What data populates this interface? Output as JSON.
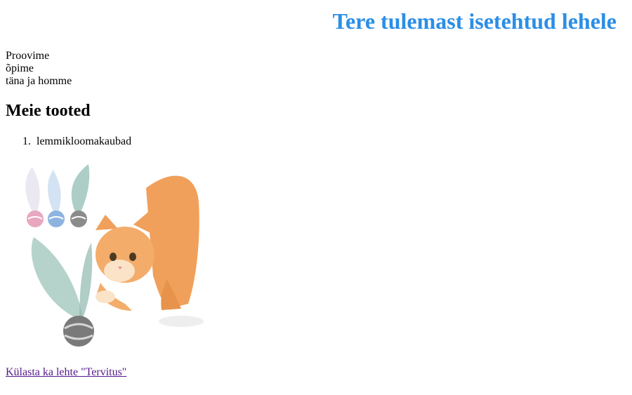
{
  "header": {
    "title": "Tere tulemast isetehtud lehele",
    "title_color": "#2b8ee6"
  },
  "intro": {
    "lines": [
      "Proovime",
      "õpime",
      "täna ja homme"
    ]
  },
  "products": {
    "heading": "Meie tooted",
    "items": [
      {
        "number": "1.",
        "label": "lemmikloomakaubad"
      }
    ],
    "image": {
      "icon": "cat-with-feather-ball-toys-image"
    }
  },
  "footer": {
    "link_text": "Külasta ka lehte \"Tervitus\"",
    "link_color": "#551a8b"
  }
}
